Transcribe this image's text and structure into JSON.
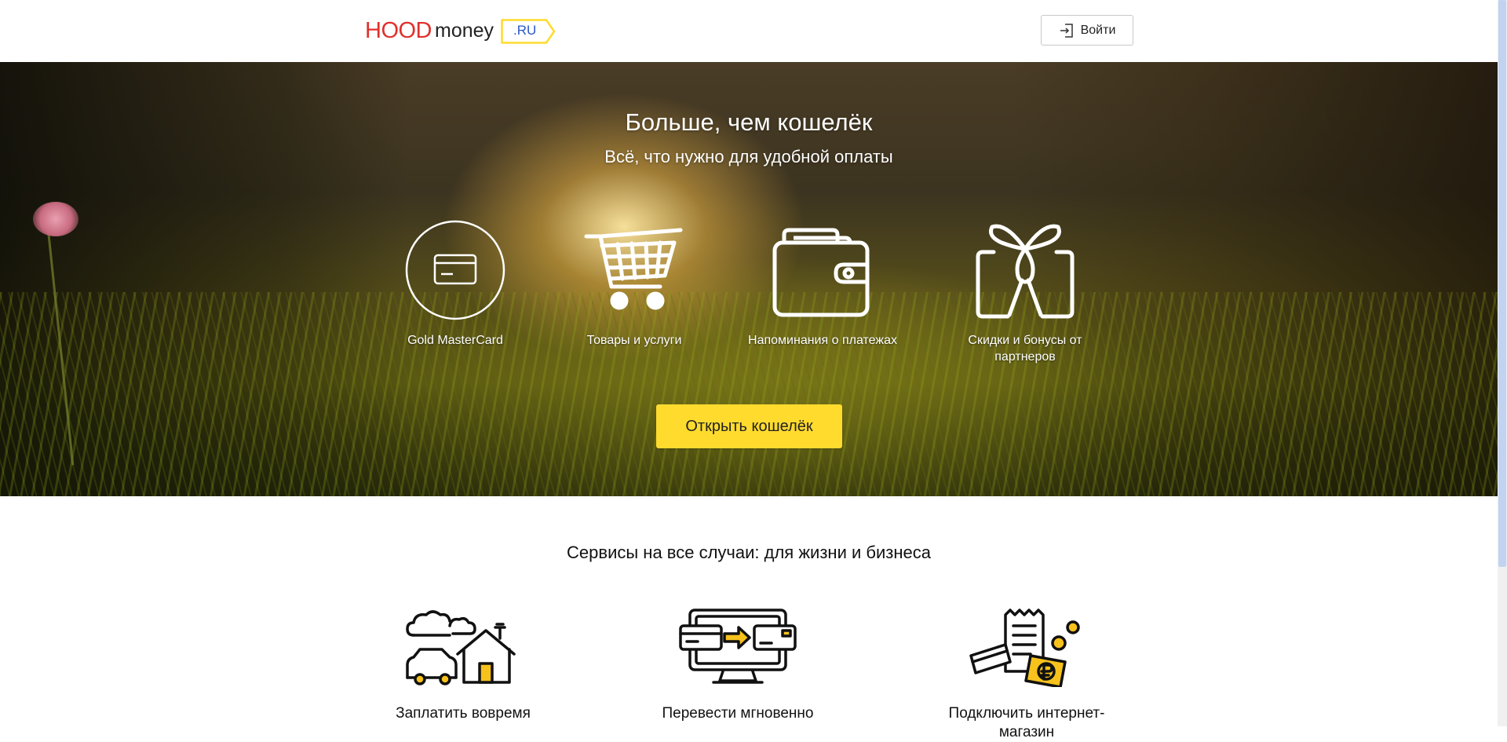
{
  "header": {
    "logo": {
      "part1": "HOOD",
      "part2": "money",
      "tag": ".RU"
    },
    "login_label": "Войти"
  },
  "hero": {
    "title": "Больше, чем кошелёк",
    "subtitle": "Всё, что нужно для удобной оплаты",
    "features": [
      {
        "label": "Gold MasterCard",
        "icon": "card-icon"
      },
      {
        "label": "Товары и услуги",
        "icon": "cart-icon"
      },
      {
        "label": "Напоминания о платежах",
        "icon": "wallet-icon"
      },
      {
        "label": "Скидки и бонусы от партнеров",
        "icon": "gift-icon"
      }
    ],
    "cta_label": "Открыть кошелёк"
  },
  "services": {
    "title": "Сервисы на все случаи: для жизни и бизнеса",
    "items": [
      {
        "label": "Заплатить вовремя",
        "icon": "home-car-icon"
      },
      {
        "label": "Перевести мгновенно",
        "icon": "transfer-monitor-icon"
      },
      {
        "label": "Подключить интернет-магазин",
        "icon": "receipt-cards-coins-icon"
      }
    ]
  },
  "colors": {
    "logo_red": "#e0302c",
    "logo_tag_blue": "#2a57c9",
    "logo_tag_yellow": "#ffdb2e",
    "cta_yellow": "#ffdb2e",
    "icon_accent": "#f7c21c"
  }
}
